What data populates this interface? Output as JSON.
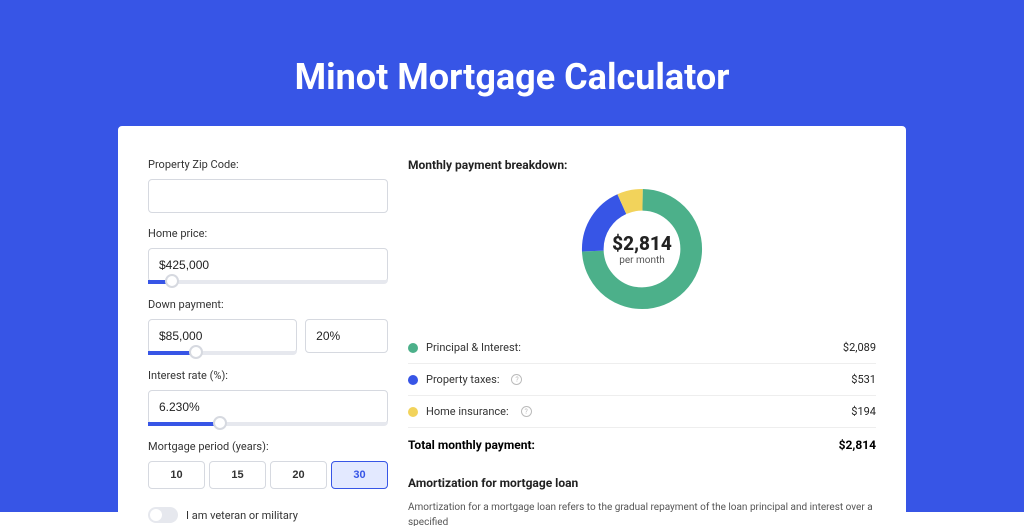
{
  "title": "Minot Mortgage Calculator",
  "form": {
    "zip_label": "Property Zip Code:",
    "zip_value": "",
    "price_label": "Home price:",
    "price_value": "$425,000",
    "down_label": "Down payment:",
    "down_value": "$85,000",
    "down_pct": "20%",
    "rate_label": "Interest rate (%):",
    "rate_value": "6.230%",
    "period_label": "Mortgage period (years):",
    "periods": [
      "10",
      "15",
      "20",
      "30"
    ],
    "period_active": "30",
    "veteran_label": "I am veteran or military"
  },
  "breakdown": {
    "heading": "Monthly payment breakdown:",
    "center_value": "$2,814",
    "center_sub": "per month",
    "items": [
      {
        "label": "Principal & Interest:",
        "value": "$2,089",
        "color": "g"
      },
      {
        "label": "Property taxes:",
        "value": "$531",
        "color": "b",
        "info": true
      },
      {
        "label": "Home insurance:",
        "value": "$194",
        "color": "y",
        "info": true
      }
    ],
    "total_label": "Total monthly payment:",
    "total_value": "$2,814"
  },
  "amort": {
    "heading": "Amortization for mortgage loan",
    "text": "Amortization for a mortgage loan refers to the gradual repayment of the loan principal and interest over a specified"
  },
  "chart_data": {
    "type": "pie",
    "title": "Monthly payment breakdown",
    "series": [
      {
        "name": "Principal & Interest",
        "value": 2089,
        "color": "#4CB08A"
      },
      {
        "name": "Property taxes",
        "value": 531,
        "color": "#3755E6"
      },
      {
        "name": "Home insurance",
        "value": 194,
        "color": "#F2D35B"
      }
    ],
    "total": 2814
  }
}
